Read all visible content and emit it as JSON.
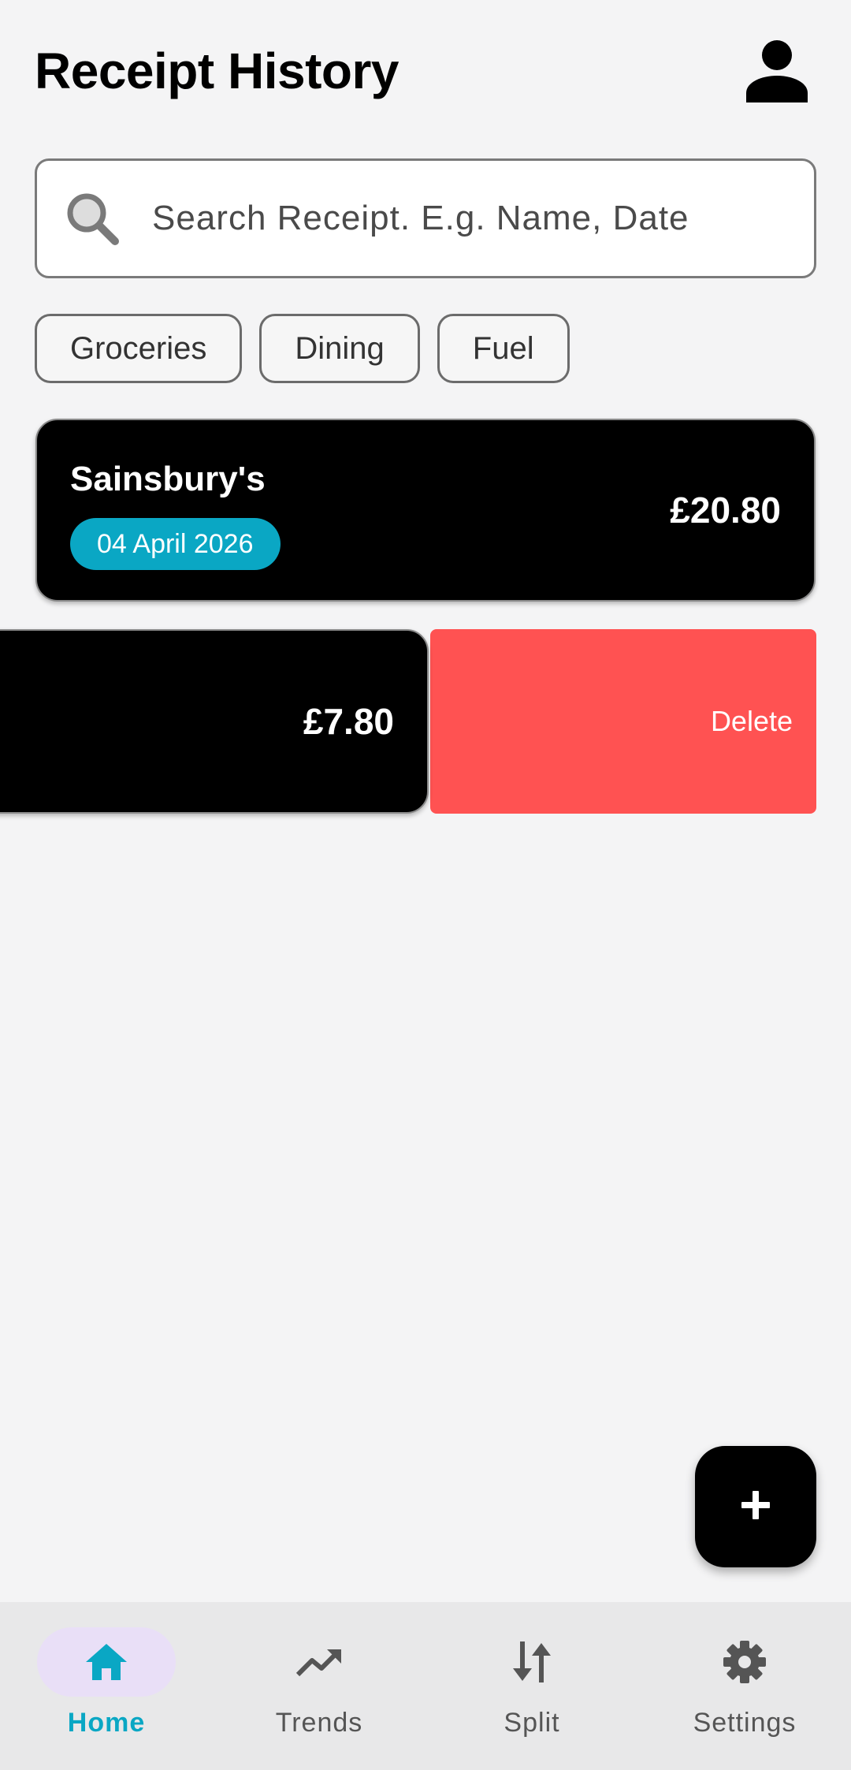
{
  "header": {
    "title": "Receipt History",
    "profile_icon": "person-icon"
  },
  "search": {
    "placeholder": "Search Receipt. E.g. Name, Date",
    "value": "",
    "icon": "search-icon"
  },
  "filters": [
    "Groceries",
    "Dining",
    "Fuel"
  ],
  "receipts": [
    {
      "merchant": "Sainsbury's",
      "date": "04 April 2026",
      "amount": "£20.80"
    },
    {
      "amount": "£7.80",
      "action_label": "Delete"
    }
  ],
  "fab": {
    "icon": "plus-icon"
  },
  "nav": {
    "items": [
      {
        "label": "Home",
        "icon": "home-icon",
        "active": true
      },
      {
        "label": "Trends",
        "icon": "trending-up-icon",
        "active": false
      },
      {
        "label": "Split",
        "icon": "sort-arrows-icon",
        "active": false
      },
      {
        "label": "Settings",
        "icon": "gear-icon",
        "active": false
      }
    ]
  },
  "colors": {
    "accent": "#0aa7c4",
    "delete": "#ff5252",
    "card": "#000000",
    "nav_active_pill": "#e9dff7",
    "background": "#f4f4f5"
  }
}
